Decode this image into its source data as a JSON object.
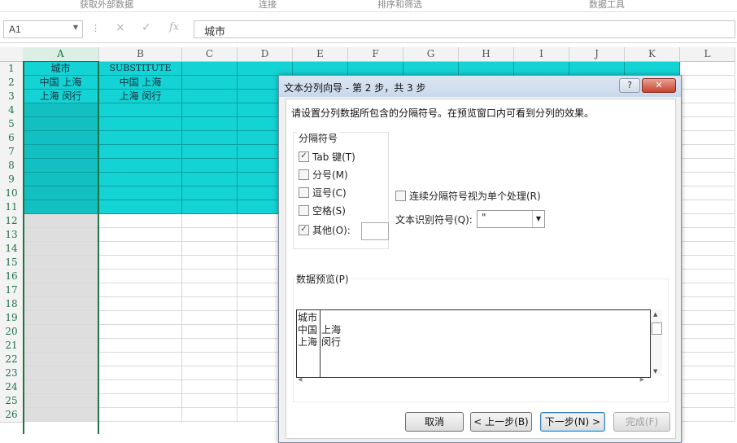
{
  "ribbon": {
    "groups": [
      "获取外部数据",
      "连接",
      "排序和筛选",
      "数据工具"
    ]
  },
  "formula_bar": {
    "name_box": "A1",
    "cancel_icon": "×",
    "enter_icon": "✓",
    "fx_label": "fx",
    "value": "城市"
  },
  "grid": {
    "columns": [
      "A",
      "B",
      "C",
      "D",
      "E",
      "F",
      "G",
      "H",
      "I",
      "J",
      "K",
      "L"
    ],
    "rows": [
      "1",
      "2",
      "3",
      "4",
      "5",
      "6",
      "7",
      "8",
      "9",
      "10",
      "11",
      "12",
      "13",
      "14",
      "15",
      "16",
      "17",
      "18",
      "19",
      "20",
      "21",
      "22",
      "23",
      "24",
      "25",
      "26"
    ],
    "cells": {
      "A1": "城市",
      "B1": "SUBSTITUTE",
      "A2": "中国 上海",
      "B2": "中国 上海",
      "A3": "上海 闵行",
      "B3": "上海 闵行"
    },
    "fill_color": "#13d3d5",
    "selection_color": "#217346"
  },
  "dialog": {
    "title": "文本分列向导 - 第 2 步，共 3 步",
    "help": "?",
    "close": "✕",
    "instruction": "请设置分列数据所包含的分隔符号。在预览窗口内可看到分列的效果。",
    "delimiters_label": "分隔符号",
    "options": [
      {
        "label": "Tab 键(T)",
        "checked": true
      },
      {
        "label": "分号(M)",
        "checked": false
      },
      {
        "label": "逗号(C)",
        "checked": false
      },
      {
        "label": "空格(S)",
        "checked": false
      },
      {
        "label": "其他(O):",
        "checked": true
      }
    ],
    "consecutive_label": "连续分隔符号视为单个处理(R)",
    "qualifier_label": "文本识别符号(Q):",
    "qualifier_value": "\"",
    "preview_label": "数据预览(P)",
    "preview": {
      "col1": [
        "城市",
        "中国",
        "上海"
      ],
      "col2": [
        "",
        "上海",
        "闵行"
      ]
    },
    "buttons": {
      "cancel": "取消",
      "back": "< 上一步(B)",
      "next": "下一步(N) >",
      "finish": "完成(F)"
    }
  }
}
